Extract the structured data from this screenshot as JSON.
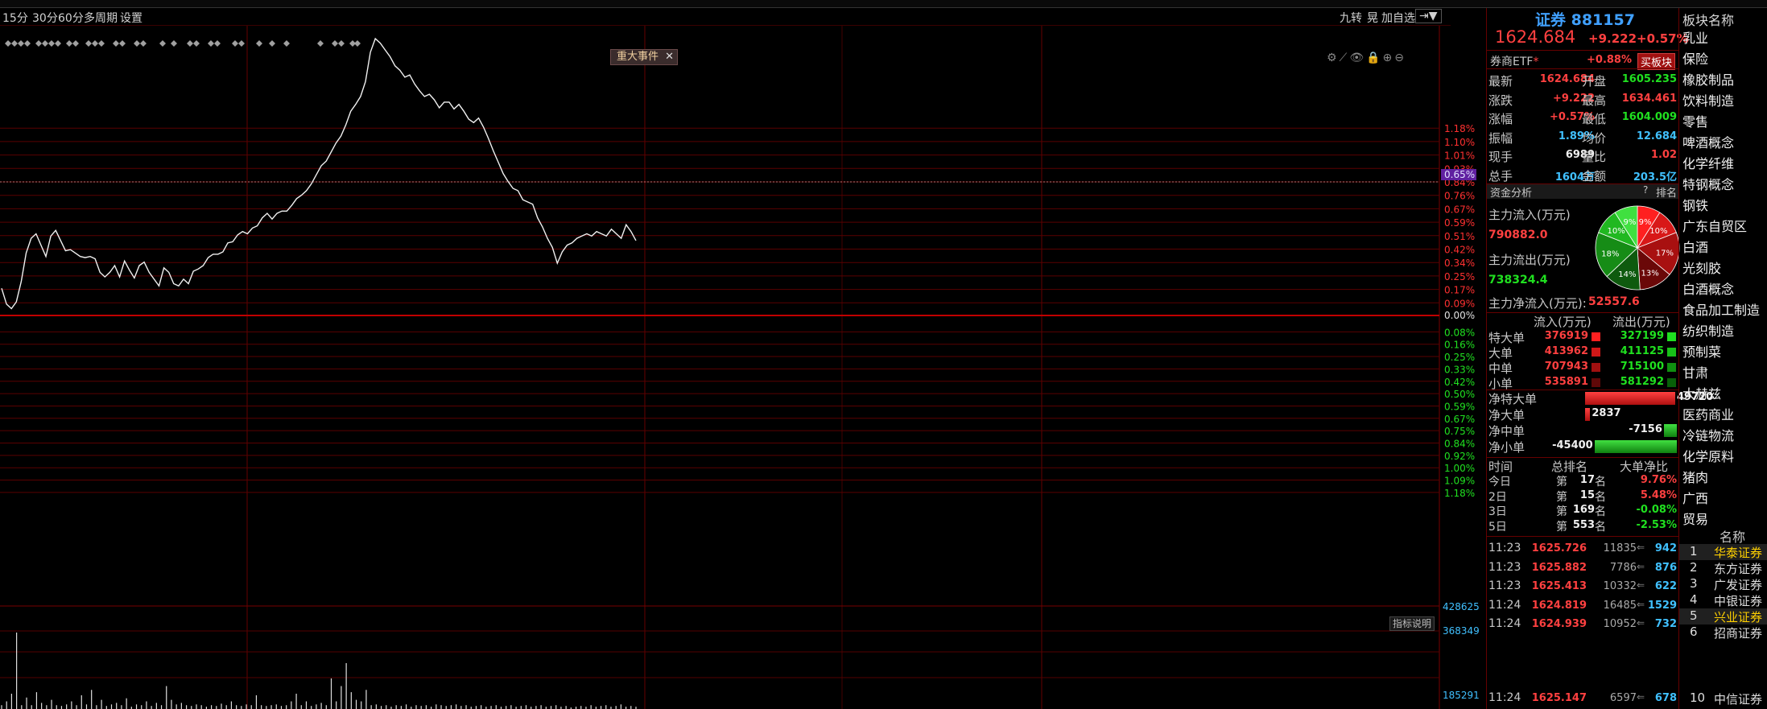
{
  "toolbar": {
    "periods": [
      "15分",
      "30分",
      "60分",
      "多周期",
      "设置"
    ],
    "right": [
      "九转",
      "晃",
      "加自选",
      "⇥▼"
    ]
  },
  "chart": {
    "event_tag": "重大事件",
    "event_close": "✕",
    "indicator_btn": "指标说明",
    "icons": "⚙⟋👁🔒⊕⊖",
    "pct_up": [
      "1.18%",
      "1.10%",
      "1.01%",
      "0.93%",
      "0.84%",
      "0.76%",
      "0.67%",
      "0.59%",
      "0.51%",
      "0.42%",
      "0.34%",
      "0.25%",
      "0.17%",
      "0.09%"
    ],
    "pct_zero": "0.00%",
    "pct_down": [
      "0.08%",
      "0.16%",
      "0.25%",
      "0.33%",
      "0.42%",
      "0.50%",
      "0.59%",
      "0.67%",
      "0.75%",
      "0.84%",
      "0.92%",
      "1.00%",
      "1.09%",
      "1.18%"
    ],
    "current_pct": "0.65%",
    "vol_labels": [
      "428625",
      "368349",
      "185291"
    ],
    "price_line": [
      0.24,
      0.1,
      0.06,
      0.12,
      0.3,
      0.55,
      0.68,
      0.72,
      0.62,
      0.52,
      0.7,
      0.75,
      0.66,
      0.57,
      0.58,
      0.55,
      0.52,
      0.51,
      0.52,
      0.5,
      0.38,
      0.34,
      0.38,
      0.44,
      0.34,
      0.48,
      0.4,
      0.33,
      0.44,
      0.47,
      0.38,
      0.32,
      0.26,
      0.42,
      0.38,
      0.28,
      0.26,
      0.32,
      0.28,
      0.39,
      0.41,
      0.44,
      0.51,
      0.54,
      0.54,
      0.56,
      0.64,
      0.65,
      0.71,
      0.74,
      0.72,
      0.77,
      0.79,
      0.86,
      0.9,
      0.85,
      0.9,
      0.92,
      0.92,
      0.97,
      1.03,
      1.06,
      1.1,
      1.16,
      1.24,
      1.32,
      1.36,
      1.44,
      1.52,
      1.58,
      1.68,
      1.8,
      1.86,
      1.93,
      2.06,
      2.32,
      2.44,
      2.4,
      2.34,
      2.28,
      2.2,
      2.16,
      2.1,
      2.12,
      2.04,
      1.98,
      1.93,
      1.95,
      1.9,
      1.83,
      1.88,
      1.88,
      1.82,
      1.86,
      1.8,
      1.73,
      1.7,
      1.74,
      1.66,
      1.56,
      1.45,
      1.35,
      1.25,
      1.18,
      1.12,
      1.1,
      1.02,
      1.0,
      0.98,
      0.86,
      0.78,
      0.68,
      0.6,
      0.46,
      0.56,
      0.62,
      0.64,
      0.68,
      0.7,
      0.72,
      0.7,
      0.74,
      0.72,
      0.7,
      0.76,
      0.72,
      0.68,
      0.8,
      0.74,
      0.66
    ],
    "volumes": [
      0.05,
      0.1,
      0.2,
      1.0,
      0.05,
      0.15,
      0.05,
      0.22,
      0.08,
      0.05,
      0.12,
      0.05,
      0.04,
      0.06,
      0.1,
      0.05,
      0.18,
      0.06,
      0.25,
      0.05,
      0.12,
      0.04,
      0.06,
      0.08,
      0.05,
      0.14,
      0.03,
      0.06,
      0.05,
      0.1,
      0.04,
      0.08,
      0.05,
      0.3,
      0.12,
      0.06,
      0.08,
      0.05,
      0.04,
      0.06,
      0.05,
      0.03,
      0.05,
      0.04,
      0.07,
      0.05,
      0.1,
      0.05,
      0.04,
      0.06,
      0.05,
      0.18,
      0.05,
      0.04,
      0.05,
      0.06,
      0.04,
      0.05,
      0.1,
      0.2,
      0.05,
      0.1,
      0.04,
      0.06,
      0.08,
      0.05,
      0.4,
      0.1,
      0.3,
      0.6,
      0.22,
      0.12,
      0.1,
      0.25,
      0.05,
      0.06,
      0.04,
      0.05,
      0.03,
      0.05,
      0.04,
      0.06,
      0.03,
      0.05,
      0.04,
      0.05,
      0.03,
      0.06,
      0.05,
      0.04,
      0.05,
      0.06,
      0.04,
      0.05,
      0.03,
      0.04,
      0.05,
      0.03,
      0.04,
      0.05,
      0.03,
      0.04,
      0.05,
      0.03,
      0.04,
      0.05,
      0.03,
      0.04,
      0.05,
      0.03,
      0.04,
      0.05,
      0.03,
      0.04,
      0.02,
      0.03,
      0.04,
      0.03,
      0.05,
      0.03,
      0.04,
      0.05,
      0.03,
      0.04,
      0.06,
      0.03,
      0.04,
      0.03
    ]
  },
  "quote": {
    "name": "证券 881157",
    "price": "1624.684",
    "change": "+9.222",
    "change_pct": "+0.57%",
    "etf_label": "券商ETF",
    "etf_mark": "*",
    "etf_pct": "+0.88%",
    "buy_btn": "买板块",
    "rows": [
      {
        "l1": "最新",
        "v1": "1624.684",
        "c1": "red",
        "l2": "开盘",
        "v2": "1605.235",
        "c2": "green"
      },
      {
        "l1": "涨跌",
        "v1": "+9.222",
        "c1": "red",
        "l2": "最高",
        "v2": "1634.461",
        "c2": "red"
      },
      {
        "l1": "涨幅",
        "v1": "+0.57%",
        "c1": "red",
        "l2": "最低",
        "v2": "1604.009",
        "c2": "green"
      },
      {
        "l1": "振幅",
        "v1": "1.89%",
        "c1": "cyan",
        "l2": "均价",
        "v2": "12.684",
        "c2": "cyan"
      },
      {
        "l1": "现手",
        "v1": "6989",
        "c1": "white",
        "l2": "量比",
        "v2": "1.02",
        "c2": "red"
      },
      {
        "l1": "总手",
        "v1": "1604万",
        "c1": "cyan",
        "l2": "金额",
        "v2": "203.5亿",
        "c2": "cyan"
      }
    ]
  },
  "fund": {
    "header": "资金分析",
    "help": "?",
    "rank_link": "排名",
    "inflow_label": "主力流入(万元)",
    "inflow_value": "790882.0",
    "outflow_label": "主力流出(万元)",
    "outflow_value": "738324.4",
    "net_label": "主力净流入(万元):",
    "net_value": "52557.6",
    "pie": [
      {
        "label": "9%",
        "value": 9,
        "color": "#ff2020"
      },
      {
        "label": "10%",
        "value": 10,
        "color": "#d81818"
      },
      {
        "label": "17%",
        "value": 17,
        "color": "#a81010"
      },
      {
        "label": "13%",
        "value": 13,
        "color": "#6a0808"
      },
      {
        "label": "14%",
        "value": 14,
        "color": "#0e5a0e"
      },
      {
        "label": "18%",
        "value": 18,
        "color": "#168c16"
      },
      {
        "label": "10%",
        "value": 10,
        "color": "#20b820"
      },
      {
        "label": "9%",
        "value": 9,
        "color": "#40e040"
      }
    ],
    "flow_header_in": "流入(万元)",
    "flow_header_out": "流出(万元)",
    "flows": [
      {
        "label": "特大单",
        "in": "376919",
        "out": "327199",
        "cin": "#ff2020",
        "cout": "#20e020"
      },
      {
        "label": "大单",
        "in": "413962",
        "out": "411125",
        "cin": "#d01818",
        "cout": "#18c018"
      },
      {
        "label": "中单",
        "in": "707943",
        "out": "715100",
        "cin": "#a01010",
        "cout": "#109010"
      },
      {
        "label": "小单",
        "in": "535891",
        "out": "581292",
        "cin": "#600808",
        "cout": "#086008"
      }
    ],
    "nets": [
      {
        "label": "净特大单",
        "value": "49720",
        "amount": 49720
      },
      {
        "label": "净大单",
        "value": "2837",
        "amount": 2837
      },
      {
        "label": "净中单",
        "value": "-7156",
        "amount": -7156
      },
      {
        "label": "净小单",
        "value": "-45400",
        "amount": -45400
      }
    ],
    "rank_header": {
      "time": "时间",
      "rank": "总排名",
      "ratio": "大单净比"
    },
    "ranks": [
      {
        "time": "今日",
        "pre": "第",
        "num": "17",
        "suf": "名",
        "ratio": "9.76%",
        "c": "red"
      },
      {
        "time": "2日",
        "pre": "第",
        "num": "15",
        "suf": "名",
        "ratio": "5.48%",
        "c": "red"
      },
      {
        "time": "3日",
        "pre": "第",
        "num": "169",
        "suf": "名",
        "ratio": "-0.08%",
        "c": "green"
      },
      {
        "time": "5日",
        "pre": "第",
        "num": "553",
        "suf": "名",
        "ratio": "-2.53%",
        "c": "green"
      }
    ]
  },
  "ticks": [
    {
      "time": "11:23",
      "price": "1625.726",
      "vol": "11835",
      "amt": "942"
    },
    {
      "time": "11:23",
      "price": "1625.882",
      "vol": "7786",
      "amt": "876"
    },
    {
      "time": "11:23",
      "price": "1625.413",
      "vol": "10332",
      "amt": "622"
    },
    {
      "time": "11:24",
      "price": "1624.819",
      "vol": "16485",
      "amt": "1529"
    },
    {
      "time": "11:24",
      "price": "1624.939",
      "vol": "10952",
      "amt": "732"
    }
  ],
  "tick_last": {
    "time": "11:24",
    "price": "1625.147",
    "vol": "6597",
    "amt": "678"
  },
  "blocks": {
    "title": "板块名称",
    "items": [
      "乳业",
      "保险",
      "橡胶制品",
      "饮料制造",
      "零售",
      "啤酒概念",
      "化学纤维",
      "特钢概念",
      "钢铁",
      "广东自贸区",
      "白酒",
      "光刻胶",
      "白酒概念",
      "食品加工制造",
      "纺织制造",
      "预制菜",
      "甘肃",
      "大赫兹",
      "医药商业",
      "冷链物流",
      "化学原料",
      "猪肉",
      "广西",
      "贸易"
    ],
    "name_header": "名称",
    "ranks": [
      {
        "n": "1",
        "name": "华泰证券",
        "hl": true
      },
      {
        "n": "2",
        "name": "东方证券",
        "hl": false
      },
      {
        "n": "3",
        "name": "广发证券",
        "hl": false
      },
      {
        "n": "4",
        "name": "中银证券",
        "hl": false
      },
      {
        "n": "5",
        "name": "兴业证券",
        "hl": true
      },
      {
        "n": "6",
        "name": "招商证券",
        "hl": false
      }
    ],
    "rank_last": {
      "n": "10",
      "name": "中信证券"
    }
  }
}
